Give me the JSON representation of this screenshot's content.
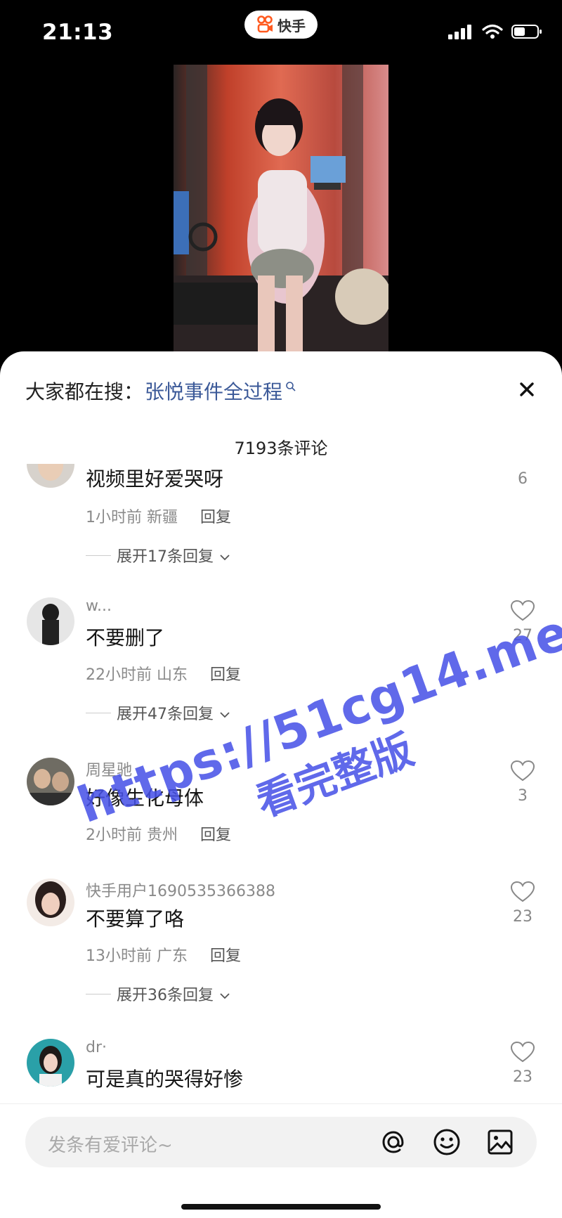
{
  "status_bar": {
    "time": "21:13",
    "app_name": "快手"
  },
  "sheet": {
    "search_prefix": "大家都在搜：",
    "search_term": "张悦事件全过程",
    "comment_count": "7193条评论"
  },
  "comments": [
    {
      "username": "",
      "text": "视频里好爱哭呀",
      "time": "1小时前",
      "location": "新疆",
      "reply_label": "回复",
      "expand": "展开17条回复",
      "likes": "6"
    },
    {
      "username": "w...",
      "text": "不要删了",
      "time": "22小时前",
      "location": "山东",
      "reply_label": "回复",
      "expand": "展开47条回复",
      "likes": "27"
    },
    {
      "username": "周星驰",
      "text": "好像生化母体",
      "time": "2小时前",
      "location": "贵州",
      "reply_label": "回复",
      "likes": "3"
    },
    {
      "username": "快手用户1690535366388",
      "text": "不要算了咯",
      "time": "13小时前",
      "location": "广东",
      "reply_label": "回复",
      "expand": "展开36条回复",
      "likes": "23"
    },
    {
      "username": "dr·",
      "text": "可是真的哭得好惨",
      "likes": "23"
    }
  ],
  "watermark": {
    "line1": "https://51cg14.me",
    "line2": "看完整版"
  },
  "input": {
    "placeholder": "发条有爱评论~"
  },
  "colors": {
    "search_term": "#3b5998",
    "brand": "#ff5a1f",
    "watermark": "#4650e6"
  }
}
